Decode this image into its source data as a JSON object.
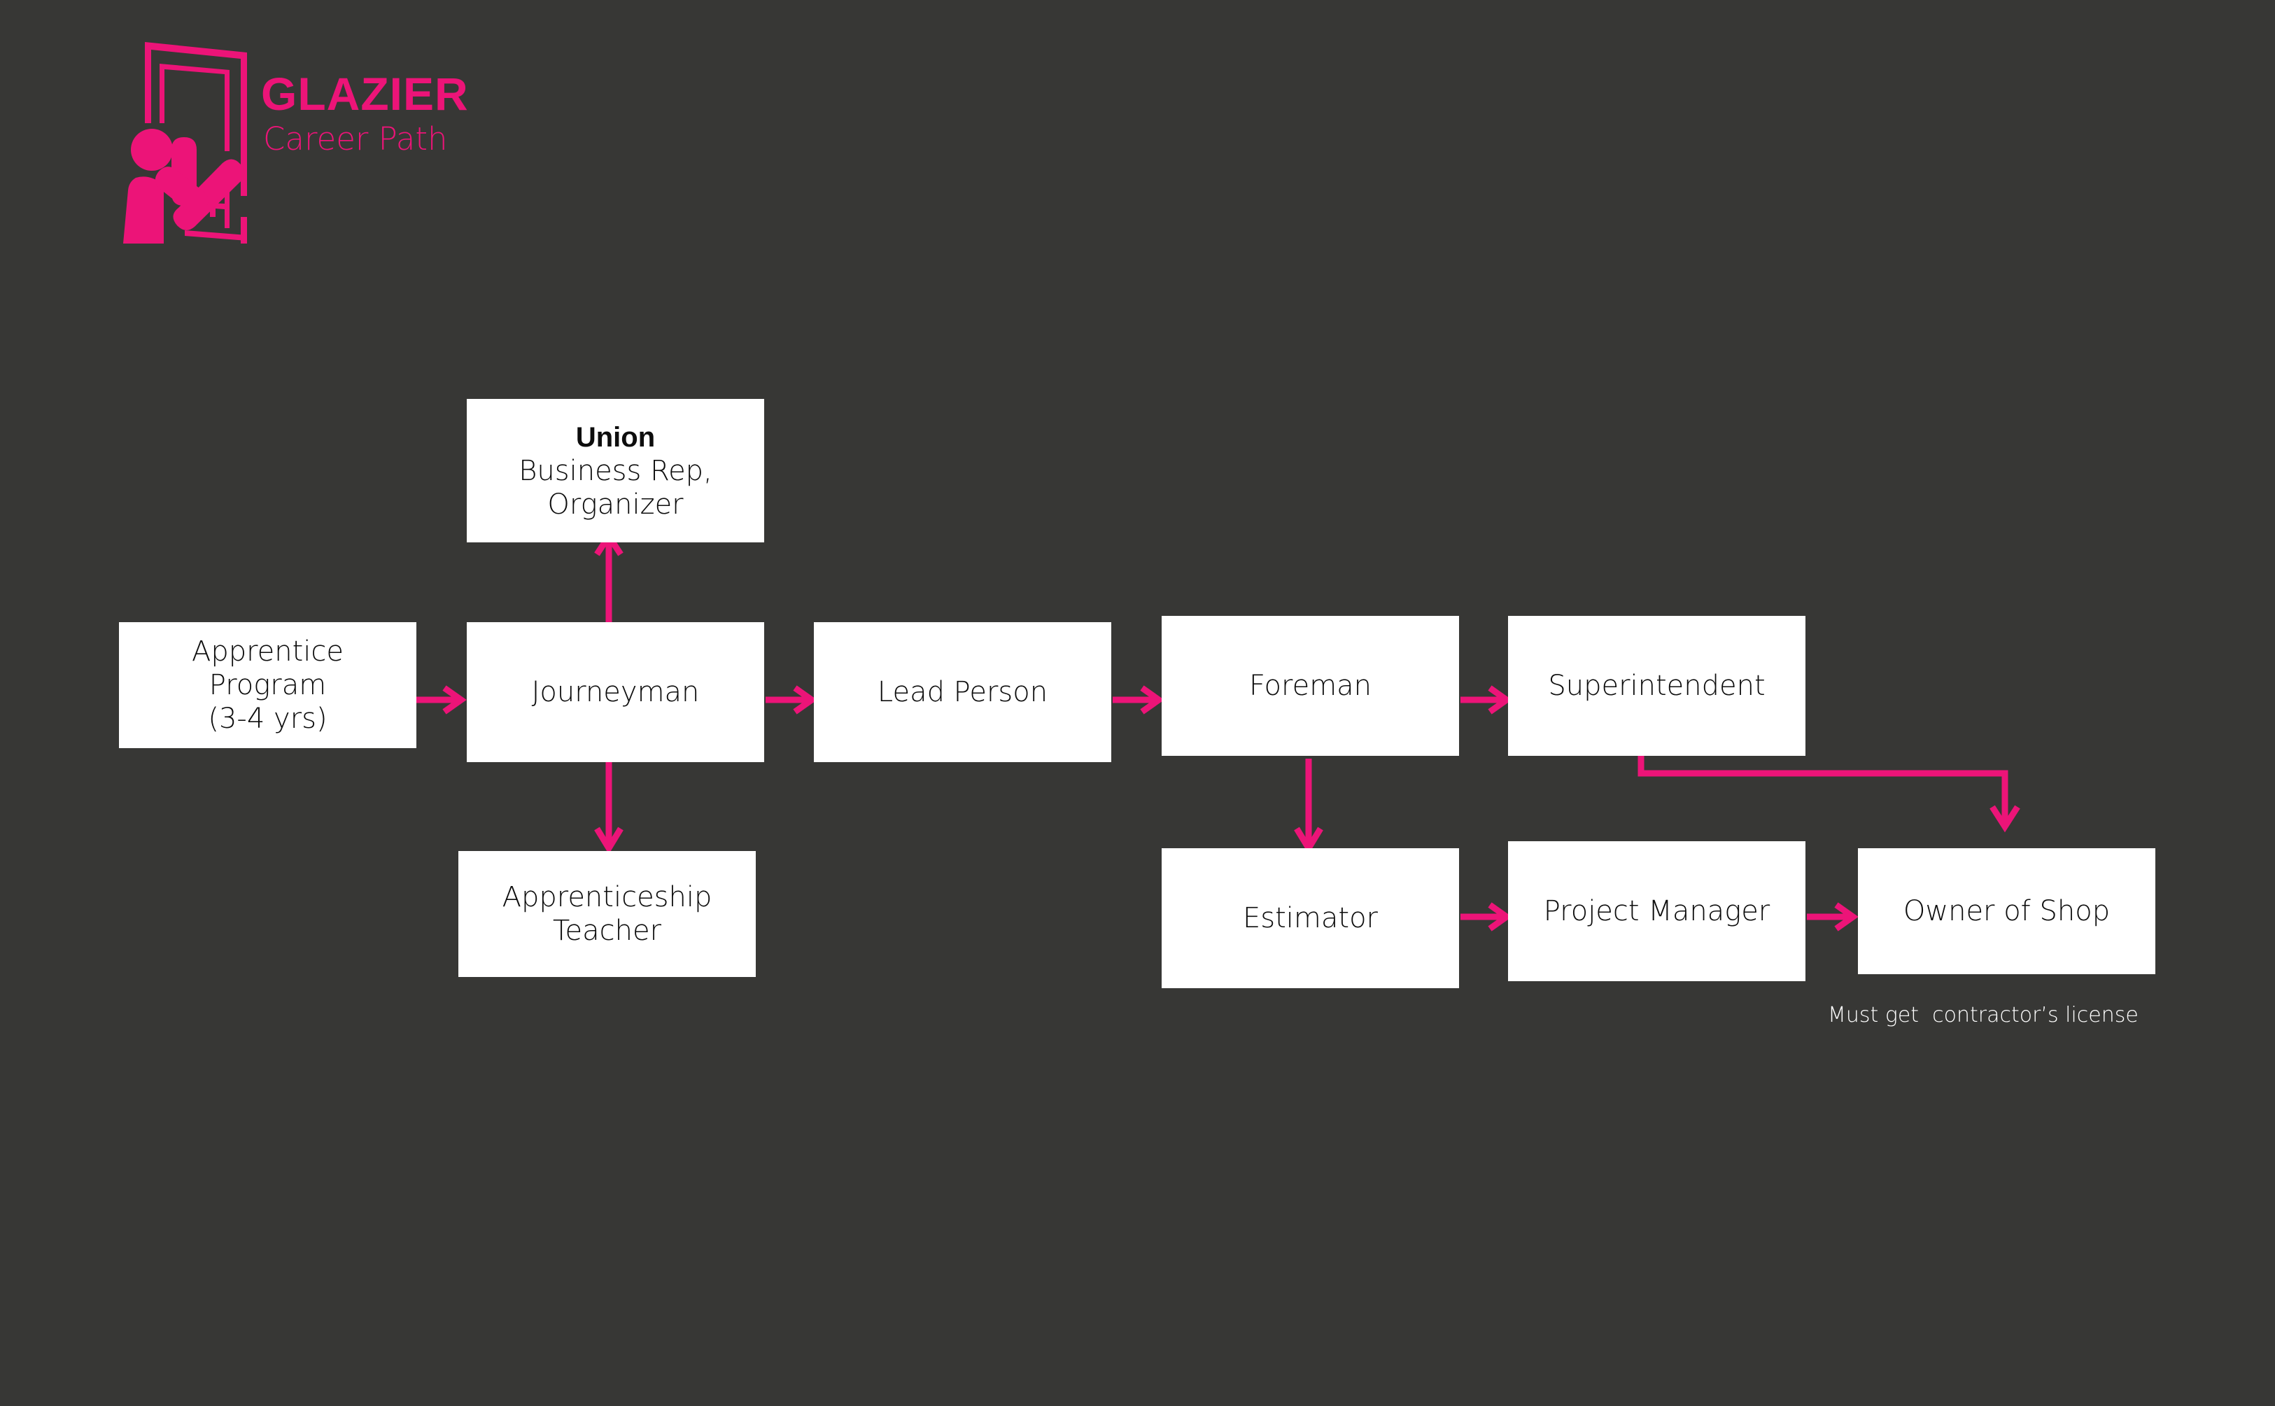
{
  "theme": {
    "background": "#373735",
    "accent": "#EC1478",
    "node_fill": "#FFFFFF",
    "node_text": "#0D0D0D",
    "caption_text": "#FFFFFF"
  },
  "logo": {
    "icon": "glazier-installing-window-icon",
    "title": "GLAZIER",
    "subtitle": "Career Path"
  },
  "diagram": {
    "nodes": {
      "union": {
        "title": "Union",
        "label": "Business Rep,\nOrganizer"
      },
      "apprentice_program": {
        "title": "",
        "label": "Apprentice\nProgram\n(3-4 yrs)"
      },
      "journeyman": {
        "title": "",
        "label": "Journeyman"
      },
      "apprenticeship_teacher": {
        "title": "",
        "label": "Apprenticeship\nTeacher"
      },
      "lead_person": {
        "title": "",
        "label": "Lead Person"
      },
      "foreman": {
        "title": "",
        "label": "Foreman"
      },
      "superintendent": {
        "title": "",
        "label": "Superintendent"
      },
      "estimator": {
        "title": "",
        "label": "Estimator"
      },
      "project_manager": {
        "title": "",
        "label": "Project Manager"
      },
      "owner_of_shop": {
        "title": "",
        "label": "Owner of Shop"
      }
    },
    "caption": "Must get  contractor’s license"
  },
  "chart_data": {
    "type": "diagram",
    "title": "GLAZIER Career Path",
    "nodes": [
      "Apprentice Program (3-4 yrs)",
      "Journeyman",
      "Union — Business Rep, Organizer",
      "Apprenticeship Teacher",
      "Lead Person",
      "Foreman",
      "Superintendent",
      "Estimator",
      "Project Manager",
      "Owner of Shop"
    ],
    "edges": [
      {
        "from": "Apprentice Program (3-4 yrs)",
        "to": "Journeyman",
        "direction": "right"
      },
      {
        "from": "Journeyman",
        "to": "Union — Business Rep, Organizer",
        "direction": "up"
      },
      {
        "from": "Journeyman",
        "to": "Apprenticeship Teacher",
        "direction": "down"
      },
      {
        "from": "Journeyman",
        "to": "Lead Person",
        "direction": "right"
      },
      {
        "from": "Lead Person",
        "to": "Foreman",
        "direction": "right"
      },
      {
        "from": "Foreman",
        "to": "Superintendent",
        "direction": "right"
      },
      {
        "from": "Foreman",
        "to": "Estimator",
        "direction": "down"
      },
      {
        "from": "Estimator",
        "to": "Project Manager",
        "direction": "right"
      },
      {
        "from": "Project Manager",
        "to": "Owner of Shop",
        "direction": "right"
      },
      {
        "from": "Superintendent",
        "to": "Owner of Shop",
        "direction": "elbow-right-down"
      }
    ],
    "annotations": [
      {
        "text": "Must get  contractor’s license",
        "attached_to": "Owner of Shop"
      }
    ]
  }
}
